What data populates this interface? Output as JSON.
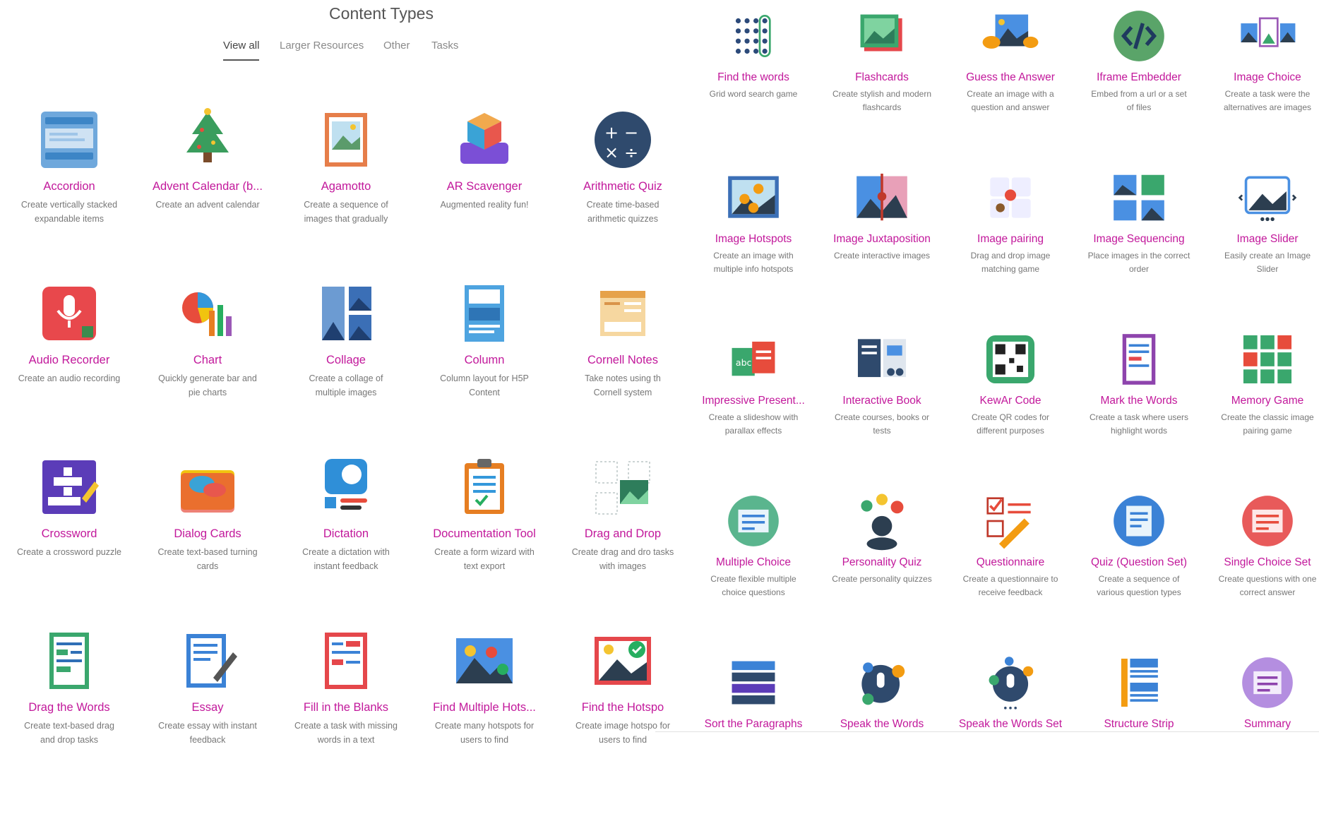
{
  "page": {
    "title": "Content Types"
  },
  "tabs": [
    {
      "label": "View all"
    },
    {
      "label": "Larger Resources"
    },
    {
      "label": "Other"
    },
    {
      "label": "Tasks"
    }
  ],
  "left_items": [
    {
      "title": "Accordion",
      "desc": "Create vertically stacked expandable items",
      "icon": "accordion-icon"
    },
    {
      "title": "Advent Calendar (b...",
      "desc": "Create an advent calendar",
      "icon": "christmas-tree-icon"
    },
    {
      "title": "Agamotto",
      "desc": "Create a sequence of images that gradually",
      "icon": "framed-picture-icon"
    },
    {
      "title": "AR Scavenger",
      "desc": "Augmented reality fun!",
      "icon": "ar-cube-icon"
    },
    {
      "title": "Arithmetic Quiz",
      "desc": "Create time-based arithmetic quizzes",
      "icon": "math-operators-icon"
    },
    {
      "title": "Audio Recorder",
      "desc": "Create an audio recording",
      "icon": "microphone-icon"
    },
    {
      "title": "Chart",
      "desc": "Quickly generate bar and pie charts",
      "icon": "chart-icon"
    },
    {
      "title": "Collage",
      "desc": "Create a collage of multiple images",
      "icon": "collage-icon"
    },
    {
      "title": "Column",
      "desc": "Column layout for H5P Content",
      "icon": "column-icon"
    },
    {
      "title": "Cornell Notes",
      "desc": "Take notes using th Cornell system",
      "icon": "notes-icon"
    },
    {
      "title": "Crossword",
      "desc": "Create a crossword puzzle",
      "icon": "crossword-icon"
    },
    {
      "title": "Dialog Cards",
      "desc": "Create text-based turning cards",
      "icon": "dialog-cards-icon"
    },
    {
      "title": "Dictation",
      "desc": "Create a dictation with instant feedback",
      "icon": "dictation-icon"
    },
    {
      "title": "Documentation Tool",
      "desc": "Create a form wizard with text export",
      "icon": "clipboard-icon"
    },
    {
      "title": "Drag and Drop",
      "desc": "Create drag and dro tasks with images",
      "icon": "drag-drop-icon"
    },
    {
      "title": "Drag the Words",
      "desc": "Create text-based drag and drop tasks",
      "icon": "drag-words-icon"
    },
    {
      "title": "Essay",
      "desc": "Create essay with instant feedback",
      "icon": "essay-icon"
    },
    {
      "title": "Fill in the Blanks",
      "desc": "Create a task with missing words in a text",
      "icon": "fill-blanks-icon"
    },
    {
      "title": "Find Multiple Hots...",
      "desc": "Create many hotspots for users to find",
      "icon": "multi-hotspot-icon"
    },
    {
      "title": "Find the Hotspo",
      "desc": "Create image hotspo for users to find",
      "icon": "hotspot-icon"
    }
  ],
  "right_items": [
    {
      "title": "Find the words",
      "desc": "Grid word search game",
      "icon": "word-search-icon"
    },
    {
      "title": "Flashcards",
      "desc": "Create stylish and modern flashcards",
      "icon": "flashcards-icon"
    },
    {
      "title": "Guess the Answer",
      "desc": "Create an image with a question and answer",
      "icon": "guess-answer-icon"
    },
    {
      "title": "Iframe Embedder",
      "desc": "Embed from a url or a set of files",
      "icon": "code-icon"
    },
    {
      "title": "Image Choice",
      "desc": "Create a task were the alternatives are images",
      "icon": "image-choice-icon"
    },
    {
      "title": "Image Hotspots",
      "desc": "Create an image with multiple info hotspots",
      "icon": "image-hotspots-icon"
    },
    {
      "title": "Image Juxtaposition",
      "desc": "Create interactive images",
      "icon": "juxtaposition-icon"
    },
    {
      "title": "Image pairing",
      "desc": "Drag and drop image matching game",
      "icon": "image-pairing-icon"
    },
    {
      "title": "Image Sequencing",
      "desc": "Place images in the correct order",
      "icon": "image-sequencing-icon"
    },
    {
      "title": "Image Slider",
      "desc": "Easily create an Image Slider",
      "icon": "image-slider-icon"
    },
    {
      "title": "Impressive Present...",
      "desc": "Create a slideshow with parallax effects",
      "icon": "presentation-icon"
    },
    {
      "title": "Interactive Book",
      "desc": "Create courses, books or tests",
      "icon": "book-icon"
    },
    {
      "title": "KewAr Code",
      "desc": "Create QR codes for different purposes",
      "icon": "qr-code-icon"
    },
    {
      "title": "Mark the Words",
      "desc": "Create a task where users highlight words",
      "icon": "mark-words-icon"
    },
    {
      "title": "Memory Game",
      "desc": "Create the classic image pairing game",
      "icon": "memory-grid-icon"
    },
    {
      "title": "Multiple Choice",
      "desc": "Create flexible multiple choice questions",
      "icon": "multiple-choice-icon"
    },
    {
      "title": "Personality Quiz",
      "desc": "Create personality quizzes",
      "icon": "personality-icon"
    },
    {
      "title": "Questionnaire",
      "desc": "Create a questionnaire to receive feedback",
      "icon": "questionnaire-icon"
    },
    {
      "title": "Quiz (Question Set)",
      "desc": "Create a sequence of various question types",
      "icon": "question-set-icon"
    },
    {
      "title": "Single Choice Set",
      "desc": "Create questions with one correct answer",
      "icon": "single-choice-icon"
    },
    {
      "title": "Sort the Paragraphs",
      "desc": "",
      "icon": "sort-paragraphs-icon"
    },
    {
      "title": "Speak the Words",
      "desc": "",
      "icon": "speak-words-icon"
    },
    {
      "title": "Speak the Words Set",
      "desc": "",
      "icon": "speak-words-set-icon"
    },
    {
      "title": "Structure Strip",
      "desc": "",
      "icon": "structure-strip-icon"
    },
    {
      "title": "Summary",
      "desc": "",
      "icon": "summary-icon"
    }
  ],
  "colors": {
    "title_accent": "#c2189b",
    "desc": "#777777"
  }
}
